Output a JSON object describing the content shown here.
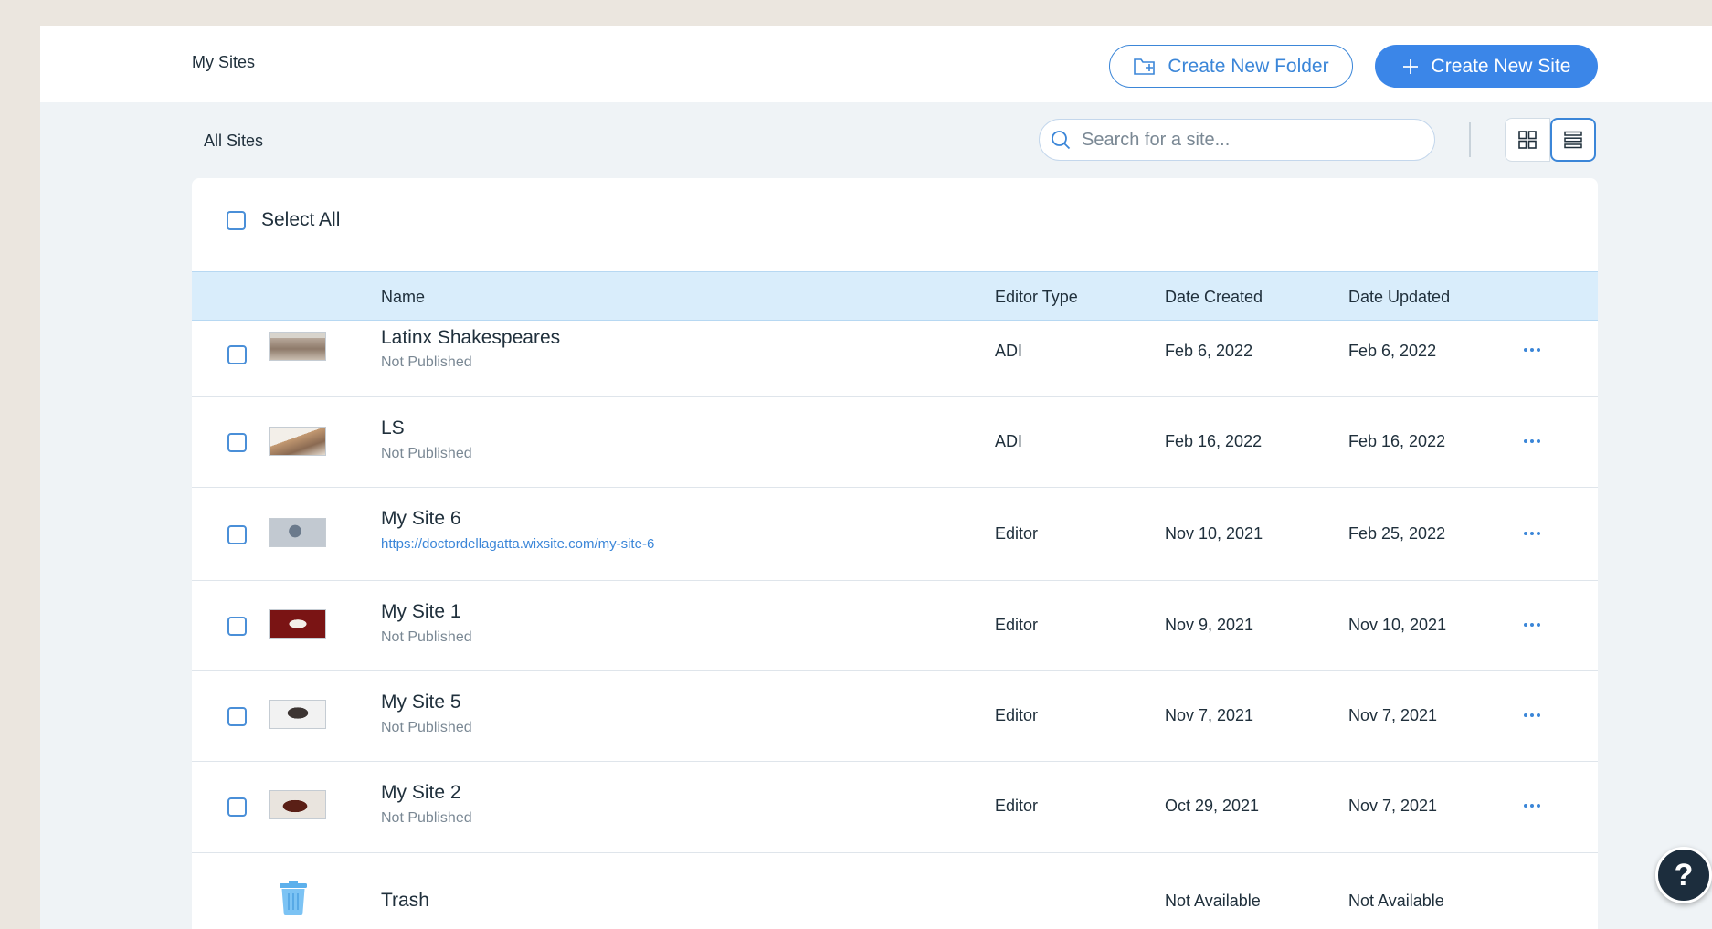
{
  "header": {
    "breadcrumb": "My Sites",
    "create_folder_label": "Create New Folder",
    "create_site_label": "Create New Site"
  },
  "toolbar": {
    "title": "All Sites",
    "search_placeholder": "Search for a site...",
    "view_mode": "list"
  },
  "table": {
    "select_all_label": "Select All",
    "columns": {
      "name": "Name",
      "editor_type": "Editor Type",
      "date_created": "Date Created",
      "date_updated": "Date Updated"
    },
    "rows": [
      {
        "name": "Latinx Shakespeares",
        "status": "Not Published",
        "editor_type": "ADI",
        "date_created": "Feb 6, 2022",
        "date_updated": "Feb 6, 2022"
      },
      {
        "name": "LS",
        "status": "Not Published",
        "editor_type": "ADI",
        "date_created": "Feb 16, 2022",
        "date_updated": "Feb 16, 2022"
      },
      {
        "name": "My Site 6",
        "status": "https://doctordellagatta.wixsite.com/my-site-6",
        "editor_type": "Editor",
        "date_created": "Nov 10, 2021",
        "date_updated": "Feb 25, 2022"
      },
      {
        "name": "My Site 1",
        "status": "Not Published",
        "editor_type": "Editor",
        "date_created": "Nov 9, 2021",
        "date_updated": "Nov 10, 2021"
      },
      {
        "name": "My Site 5",
        "status": "Not Published",
        "editor_type": "Editor",
        "date_created": "Nov 7, 2021",
        "date_updated": "Nov 7, 2021"
      },
      {
        "name": "My Site 2",
        "status": "Not Published",
        "editor_type": "Editor",
        "date_created": "Oct 29, 2021",
        "date_updated": "Nov 7, 2021"
      }
    ],
    "trash": {
      "name": "Trash",
      "date_created": "Not Available",
      "date_updated": "Not Available"
    }
  },
  "help": {
    "label": "?"
  },
  "colors": {
    "accent": "#3b86e8",
    "header_row": "#d9edfb",
    "help_bg": "#1c2d3d"
  }
}
